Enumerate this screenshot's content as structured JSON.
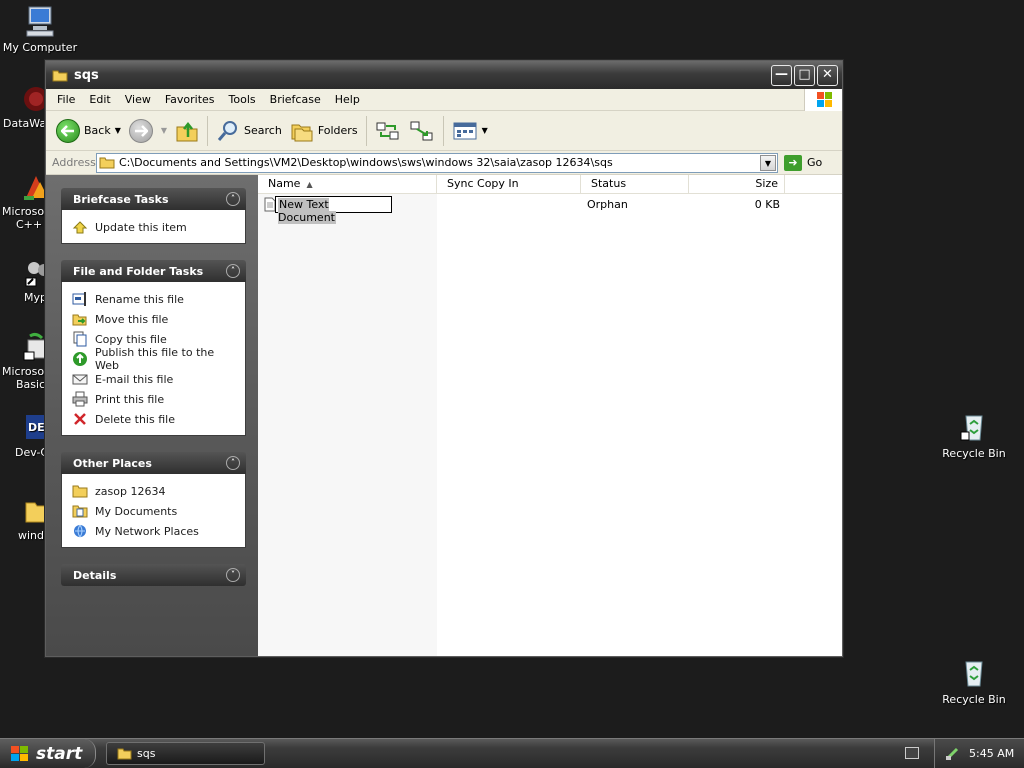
{
  "desktop": {
    "icons": [
      {
        "label": "My Computer",
        "icon": "computer-icon"
      },
      {
        "label": "DataWa",
        "icon": "datawave-icon"
      },
      {
        "label": "Microsoft",
        "label2": "C++",
        "icon": "visual-cpp-icon"
      },
      {
        "label": "Myp",
        "icon": "shortcut-icon"
      },
      {
        "label": "Microsoft",
        "label2": "Basic",
        "icon": "visual-basic-icon"
      },
      {
        "label": "Dev-C",
        "icon": "dev-cpp-icon"
      },
      {
        "label": "windo",
        "icon": "folder-icon"
      },
      {
        "label": "Recycle Bin",
        "icon": "recycle-bin-icon"
      },
      {
        "label": "Recycle Bin",
        "icon": "recycle-bin-icon"
      }
    ]
  },
  "window": {
    "title": "sqs",
    "menu": [
      "File",
      "Edit",
      "View",
      "Favorites",
      "Tools",
      "Briefcase",
      "Help"
    ],
    "toolbar": {
      "back": "Back",
      "search": "Search",
      "folders": "Folders"
    },
    "address": {
      "label": "Address",
      "value": "C:\\Documents and Settings\\VM2\\Desktop\\windows\\sws\\windows 32\\saia\\zasop 12634\\sqs",
      "go": "Go"
    },
    "taskpane": {
      "briefcase": {
        "title": "Briefcase Tasks",
        "items": [
          "Update this item"
        ]
      },
      "file_folder": {
        "title": "File and Folder Tasks",
        "items": [
          "Rename this file",
          "Move this file",
          "Copy this file",
          "Publish this file to the Web",
          "E-mail this file",
          "Print this file",
          "Delete this file"
        ]
      },
      "other_places": {
        "title": "Other Places",
        "items": [
          "zasop 12634",
          "My Documents",
          "My Network Places"
        ]
      },
      "details": {
        "title": "Details"
      }
    },
    "filelist": {
      "columns": [
        "Name",
        "Sync Copy In",
        "Status",
        "Size"
      ],
      "rows": [
        {
          "name": "New Text Document",
          "sync": "",
          "status": "Orphan",
          "size": "0 KB"
        }
      ]
    }
  },
  "taskbar": {
    "start": "start",
    "task": "sqs",
    "clock": "5:45 AM"
  },
  "colors": {
    "taskpane_bg": "#5a5a5a",
    "header_bg": "#2f2f2f",
    "address_border": "#7f9db9",
    "go_green": "#3f9e2d"
  }
}
